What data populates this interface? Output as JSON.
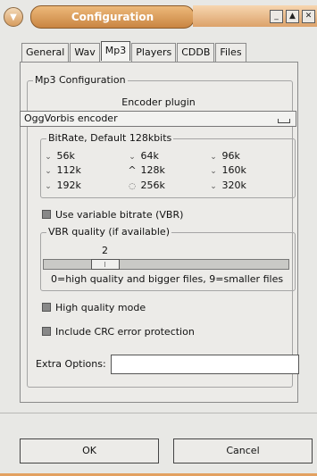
{
  "window": {
    "title": "Configuration",
    "controls": [
      "minimize-icon",
      "maximize-icon",
      "close-icon"
    ]
  },
  "tabs": [
    {
      "label": "General",
      "active": false
    },
    {
      "label": "Wav",
      "active": false
    },
    {
      "label": "Mp3",
      "active": true
    },
    {
      "label": "Players",
      "active": false
    },
    {
      "label": "CDDB",
      "active": false
    },
    {
      "label": "Files",
      "active": false
    }
  ],
  "mp3_config": {
    "group_label": "Mp3 Configuration",
    "encoder_label": "Encoder plugin",
    "encoder_selected": "OggVorbis encoder",
    "bitrate_label": "BitRate, Default 128kbits",
    "bitrates": [
      {
        "label": "56k",
        "selected": false
      },
      {
        "label": "64k",
        "selected": false
      },
      {
        "label": "96k",
        "selected": false
      },
      {
        "label": "112k",
        "selected": false
      },
      {
        "label": "128k",
        "selected": true
      },
      {
        "label": "160k",
        "selected": false
      },
      {
        "label": "192k",
        "selected": false
      },
      {
        "label": "256k",
        "selected": false
      },
      {
        "label": "320k",
        "selected": false
      }
    ],
    "vbr_checkbox_label": "Use variable bitrate (VBR)",
    "vbr_quality_label": "VBR quality (if available)",
    "vbr_quality_value": "2",
    "vbr_quality_fraction": 0.22,
    "vbr_help": "0=high quality and bigger files, 9=smaller files",
    "high_quality_label": "High quality mode",
    "crc_label": "Include CRC error protection",
    "extra_options_label": "Extra Options:",
    "extra_options_value": ""
  },
  "buttons": {
    "ok": "OK",
    "cancel": "Cancel"
  },
  "colors": {
    "title_accent": "#d08c4a",
    "background": "#e8e8e5"
  }
}
